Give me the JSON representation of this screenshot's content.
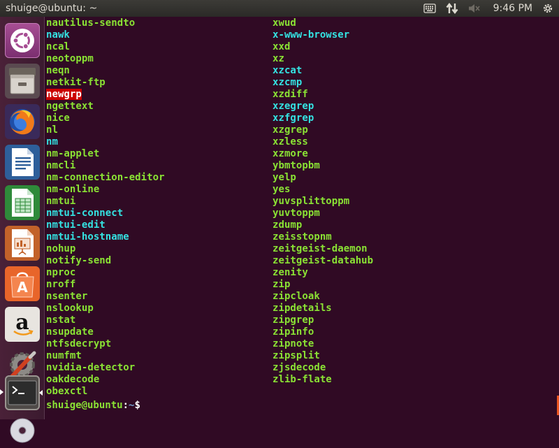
{
  "window": {
    "title": "shuige@ubuntu: ~"
  },
  "tray": {
    "icons": [
      "keyboard-icon",
      "network-transfer-icon",
      "volume-muted-icon"
    ],
    "clock": "9:46 PM",
    "settings_icon": "power-gear-icon"
  },
  "launcher": {
    "items": [
      {
        "name": "ubuntu-dash",
        "icon": "ubuntu-logo-icon"
      },
      {
        "name": "files",
        "icon": "file-cabinet-icon"
      },
      {
        "name": "firefox",
        "icon": "firefox-icon"
      },
      {
        "name": "libreoffice-writer",
        "icon": "writer-document-icon"
      },
      {
        "name": "libreoffice-calc",
        "icon": "calc-spreadsheet-icon"
      },
      {
        "name": "libreoffice-impress",
        "icon": "impress-presentation-icon"
      },
      {
        "name": "ubuntu-software",
        "icon": "software-bag-icon"
      },
      {
        "name": "amazon",
        "icon": "amazon-icon"
      },
      {
        "name": "system-settings",
        "icon": "settings-tools-icon"
      },
      {
        "name": "terminal",
        "icon": "terminal-icon"
      },
      {
        "name": "dvd",
        "icon": "disc-icon"
      }
    ],
    "colors": {
      "orange": "#e95420",
      "purple": "#77216f"
    }
  },
  "terminal": {
    "colors": {
      "background": "#300a24",
      "executable": "#8ae234",
      "symlink": "#34e2e2",
      "setuid_bg": "#cc0000",
      "prompt_path": "#729fcf"
    },
    "column1": [
      {
        "text": "nautilus-sendto",
        "type": "exec"
      },
      {
        "text": "nawk",
        "type": "link"
      },
      {
        "text": "ncal",
        "type": "exec"
      },
      {
        "text": "neotoppm",
        "type": "exec"
      },
      {
        "text": "neqn",
        "type": "exec"
      },
      {
        "text": "netkit-ftp",
        "type": "exec"
      },
      {
        "text": "newgrp",
        "type": "setuid"
      },
      {
        "text": "ngettext",
        "type": "exec"
      },
      {
        "text": "nice",
        "type": "exec"
      },
      {
        "text": "nl",
        "type": "exec"
      },
      {
        "text": "nm",
        "type": "link"
      },
      {
        "text": "nm-applet",
        "type": "exec"
      },
      {
        "text": "nmcli",
        "type": "exec"
      },
      {
        "text": "nm-connection-editor",
        "type": "exec"
      },
      {
        "text": "nm-online",
        "type": "exec"
      },
      {
        "text": "nmtui",
        "type": "exec"
      },
      {
        "text": "nmtui-connect",
        "type": "link"
      },
      {
        "text": "nmtui-edit",
        "type": "link"
      },
      {
        "text": "nmtui-hostname",
        "type": "link"
      },
      {
        "text": "nohup",
        "type": "exec"
      },
      {
        "text": "notify-send",
        "type": "exec"
      },
      {
        "text": "nproc",
        "type": "exec"
      },
      {
        "text": "nroff",
        "type": "exec"
      },
      {
        "text": "nsenter",
        "type": "exec"
      },
      {
        "text": "nslookup",
        "type": "exec"
      },
      {
        "text": "nstat",
        "type": "exec"
      },
      {
        "text": "nsupdate",
        "type": "exec"
      },
      {
        "text": "ntfsdecrypt",
        "type": "exec"
      },
      {
        "text": "numfmt",
        "type": "exec"
      },
      {
        "text": "nvidia-detector",
        "type": "exec"
      },
      {
        "text": "oakdecode",
        "type": "exec"
      },
      {
        "text": "obexctl",
        "type": "exec"
      }
    ],
    "column2": [
      {
        "text": "xwud",
        "type": "exec"
      },
      {
        "text": "x-www-browser",
        "type": "link"
      },
      {
        "text": "xxd",
        "type": "exec"
      },
      {
        "text": "xz",
        "type": "exec"
      },
      {
        "text": "xzcat",
        "type": "link"
      },
      {
        "text": "xzcmp",
        "type": "link"
      },
      {
        "text": "xzdiff",
        "type": "exec"
      },
      {
        "text": "xzegrep",
        "type": "link"
      },
      {
        "text": "xzfgrep",
        "type": "link"
      },
      {
        "text": "xzgrep",
        "type": "exec"
      },
      {
        "text": "xzless",
        "type": "exec"
      },
      {
        "text": "xzmore",
        "type": "exec"
      },
      {
        "text": "ybmtopbm",
        "type": "exec"
      },
      {
        "text": "yelp",
        "type": "exec"
      },
      {
        "text": "yes",
        "type": "exec"
      },
      {
        "text": "yuvsplittoppm",
        "type": "exec"
      },
      {
        "text": "yuvtoppm",
        "type": "exec"
      },
      {
        "text": "zdump",
        "type": "exec"
      },
      {
        "text": "zeisstopnm",
        "type": "exec"
      },
      {
        "text": "zeitgeist-daemon",
        "type": "exec"
      },
      {
        "text": "zeitgeist-datahub",
        "type": "exec"
      },
      {
        "text": "zenity",
        "type": "exec"
      },
      {
        "text": "zip",
        "type": "exec"
      },
      {
        "text": "zipcloak",
        "type": "exec"
      },
      {
        "text": "zipdetails",
        "type": "exec"
      },
      {
        "text": "zipgrep",
        "type": "exec"
      },
      {
        "text": "zipinfo",
        "type": "exec"
      },
      {
        "text": "zipnote",
        "type": "exec"
      },
      {
        "text": "zipsplit",
        "type": "exec"
      },
      {
        "text": "zjsdecode",
        "type": "exec"
      },
      {
        "text": "zlib-flate",
        "type": "exec"
      }
    ],
    "prompt": {
      "user_host": "shuige@ubuntu",
      "separator": ":",
      "path": "~",
      "symbol": "$"
    }
  }
}
